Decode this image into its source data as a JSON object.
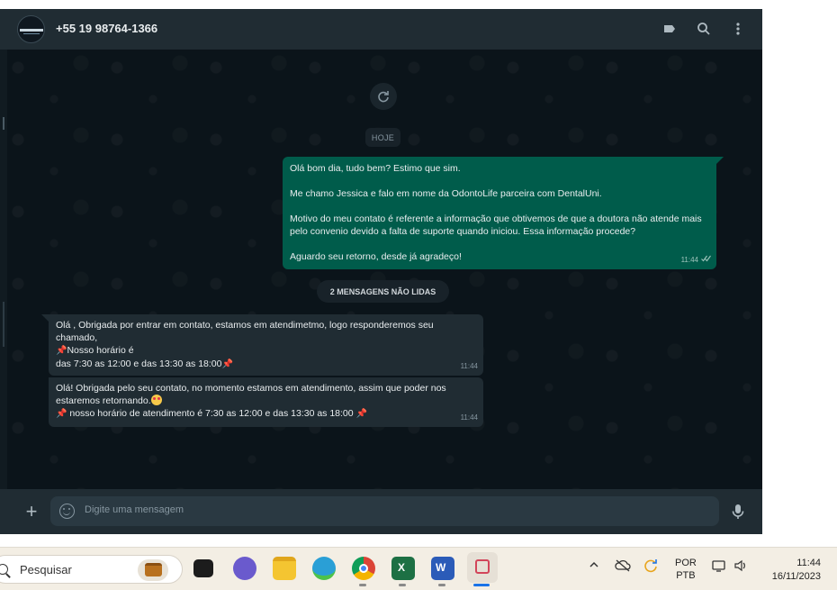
{
  "chat": {
    "contact_name": "+55 19 98764-1366",
    "date_label": "HOJE",
    "unread_label": "2 MENSAGENS NÃO LIDAS",
    "outgoing": {
      "lines": [
        "Olá bom dia, tudo bem? Estimo que sim.",
        "",
        "Me chamo Jessica e falo em nome da OdontoLife parceira com DentalUni.",
        "",
        "Motivo do meu contato é referente a informação que obtivemos de que a doutora não atende mais",
        "pelo convenio devido a falta de suporte quando iniciou. Essa informação procede?",
        "",
        "Aguardo seu retorno, desde já agradeço!"
      ],
      "time": "11:44",
      "status": "read-ticks"
    },
    "incoming": [
      {
        "line1": "Olá , Obrigada por entrar em contato, estamos em atendimetmo, logo responderemos seu",
        "line2": "chamado,",
        "line3": "Nosso horário é",
        "line4": "das 7:30 as 12:00 e das 13:30 as 18:00",
        "time": "11:44"
      },
      {
        "line1": "Olá! Obrigada pelo seu contato, no momento estamos em atendimento, assim que poder nos",
        "line2": "estaremos retornando.",
        "line3": "nosso horário de atendimento é 7:30 as 12:00 e das 13:30 as 18:00",
        "time": "11:44"
      }
    ]
  },
  "composer": {
    "placeholder": "Digite uma mensagem"
  },
  "taskbar": {
    "search_label": "Pesquisar",
    "apps": [
      "file-explorer-black",
      "teams",
      "folder",
      "edge",
      "chrome",
      "excel",
      "word",
      "snipping-tool"
    ],
    "lang_line1": "POR",
    "lang_line2": "PTB",
    "time": "11:44",
    "date": "16/11/2023"
  },
  "colors": {
    "app_bg": "#0b141a",
    "header_bg": "#202c33",
    "outgoing_bubble": "#005c4b",
    "incoming_bubble": "#202c33",
    "taskbar_bg": "#f3eee4"
  }
}
